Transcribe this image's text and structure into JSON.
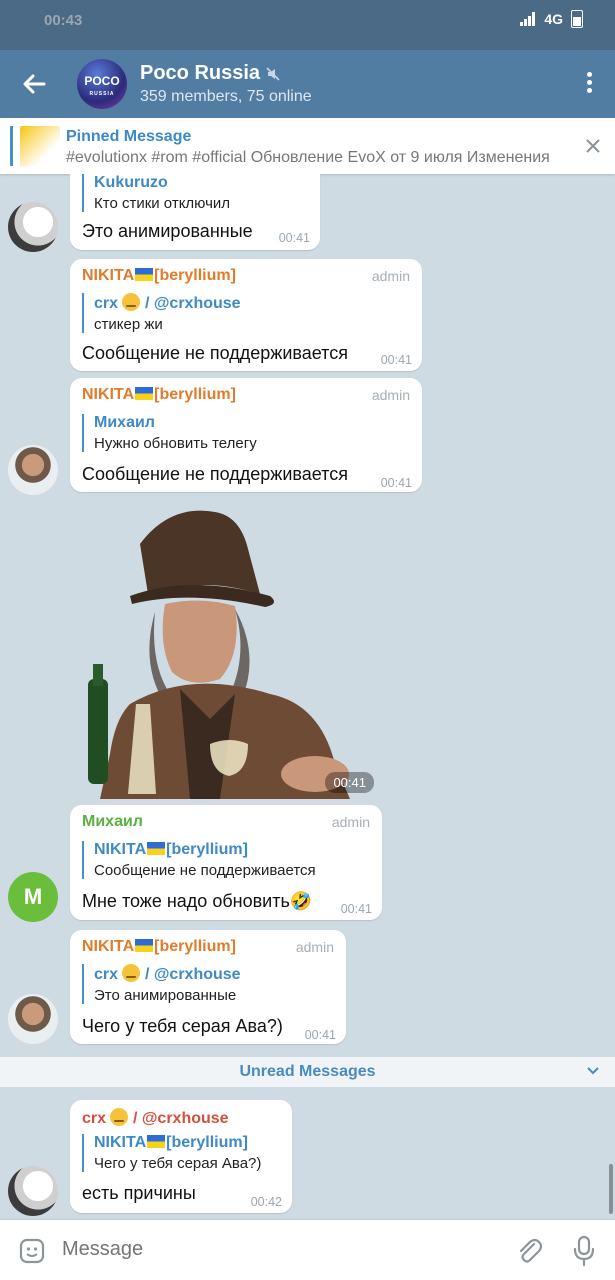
{
  "status": {
    "time": "00:43",
    "network": "4G"
  },
  "header": {
    "title": "Poco Russia",
    "subtitle": "359 members, 75 online",
    "avatar_text_1": "POCO",
    "avatar_text_2": "RUSSIA"
  },
  "pinned": {
    "title": "Pinned Message",
    "text": "#evolutionx #rom #official Обновление EvoX от 9 июля  Изменения"
  },
  "messages": [
    {
      "reply_name": "Kukuruzo",
      "reply_text": "Кто стики отключил",
      "text": "Это анимированные",
      "time": "00:41"
    },
    {
      "sender_prefix": "NIKITA",
      "sender_suffix": "[beryllium]",
      "role": "admin",
      "reply_name_a": "crx",
      "reply_name_b": "/ @crxhouse",
      "reply_text": "стикер жи",
      "text": "Сообщение не поддерживается",
      "time": "00:41"
    },
    {
      "sender_prefix": "NIKITA",
      "sender_suffix": "[beryllium]",
      "role": "admin",
      "reply_name": "Михаил",
      "reply_text": "Нужно обновить телегу",
      "text": "Сообщение не поддерживается",
      "time": "00:41"
    },
    {
      "type": "sticker",
      "time": "00:41"
    },
    {
      "sender": "Михаил",
      "avatar_letter": "M",
      "role": "admin",
      "reply_name_prefix": "NIKITA",
      "reply_name_suffix": "[beryllium]",
      "reply_text": "Сообщение не поддерживается",
      "text": "Мне тоже надо обновить🤣",
      "time": "00:41"
    },
    {
      "sender_prefix": "NIKITA",
      "sender_suffix": "[beryllium]",
      "role": "admin",
      "reply_name_a": "crx",
      "reply_name_b": "/ @crxhouse",
      "reply_text": "Это анимированные",
      "text": "Чего у тебя серая Ава?)",
      "time": "00:41"
    },
    {
      "sender_a": "crx",
      "sender_b": "/ @crxhouse",
      "reply_name_prefix": "NIKITA",
      "reply_name_suffix": "[beryllium]",
      "reply_text": "Чего у тебя серая Ава?)",
      "text": "есть причины",
      "time": "00:42"
    }
  ],
  "unread_label": "Unread Messages",
  "composer": {
    "placeholder": "Message"
  },
  "colors": {
    "header": "#527da3",
    "statusbar": "#4b6a86",
    "accent": "#3d8ac6",
    "admin_name": "#e07c2b",
    "mikhail_name": "#58b240",
    "crx_name": "#d4503c"
  }
}
